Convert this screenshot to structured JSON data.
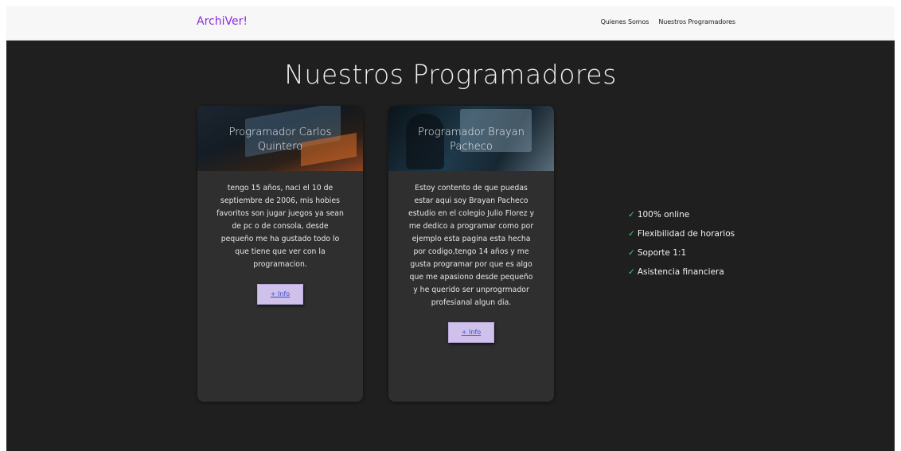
{
  "navbar": {
    "brand": "ArchiVer!",
    "links": [
      "Quienes Somos",
      "Nuestros Programadores"
    ]
  },
  "main": {
    "title": "Nuestros Programadores",
    "cards": [
      {
        "title": "Programador Carlos Quintero",
        "text": "tengo 15 años, naci el 10 de septiembre de 2006, mis hobies favoritos son jugar juegos ya sean de pc o de consola, desde pequeño me ha gustado todo lo que tiene que ver con la programacion.",
        "button": "+ Info"
      },
      {
        "title": "Programador Brayan Pacheco",
        "text": "Estoy contento de que puedas estar aqui soy Brayan Pacheco estudio en el colegio Julio Florez y me dedico a programar como por ejemplo esta pagina esta hecha por codigo,tengo 14 años y me gusta programar por que es algo que me apasiono desde pequeño y he querido ser unprogrmador profesianal algun dia.",
        "button": "+ Info"
      }
    ],
    "features": [
      {
        "check": "✓",
        "label": "100% online"
      },
      {
        "check": "✓",
        "label": "Flexibilidad de horarios"
      },
      {
        "check": "✓",
        "label": "Soporte 1:1"
      },
      {
        "check": "✓",
        "label": "Asistencia financiera"
      }
    ]
  }
}
